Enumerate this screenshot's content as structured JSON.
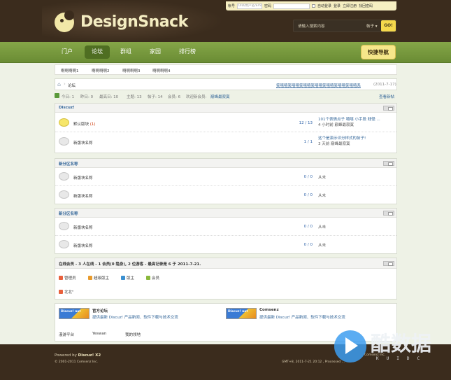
{
  "colors": {
    "header_bg": "#3b2c1d",
    "nav_green": "#6a8c34",
    "accent_yellow": "#f4d84c",
    "link_blue": "#336699",
    "new_count_red": "#cc3300"
  },
  "topbar": {
    "account_label": "帐号",
    "account_placeholder": "UID/用户名/Email",
    "password_label": "密码",
    "auto_login": "自动登录",
    "login": "登录",
    "register": "立即注册",
    "forgot": "找回密码"
  },
  "logo": {
    "text": "DesignSnack"
  },
  "search": {
    "placeholder": "请输入搜索内容",
    "type": "帖子",
    "button": "GO!"
  },
  "nav": {
    "items": [
      "门户",
      "论坛",
      "群组",
      "家园",
      "排行榜"
    ],
    "active": "论坛",
    "quick": "快捷导航"
  },
  "subnav": {
    "items": [
      "啊啊啊啊1",
      "啊啊啊啊2",
      "啊啊啊啊3",
      "啊啊啊啊4"
    ]
  },
  "breadcrumb": {
    "home_icon": "home-icon",
    "current": "论坛",
    "announcement": "笑嘻嘻笑嘻嘻笑嘻嘻笑嘻嘻笑嘻嘻笑嘻嘻笑嘻嘻系",
    "announcement_date": "(2011-7-17)"
  },
  "stats": {
    "today": "今日: 1",
    "yesterday": "昨日: 0",
    "max": "最高日: 10",
    "threads": "主题: 13",
    "posts": "帖子: 14",
    "members": "会员: 6",
    "welcome": "欢迎新会员:",
    "new_member": "巅峰最寂寞",
    "view_new": "查看新帖"
  },
  "sections": [
    {
      "title": "Discuz!",
      "forums": [
        {
          "name": "默认版块",
          "new_count": "(1)",
          "count": "12 / 13",
          "last_title": "101个表情点子 嘻嘻 小手段 贱怪 ...",
          "last_meta": "4 小时前 巅峰最寂寞",
          "is_new": true
        },
        {
          "name": "新版块名称",
          "new_count": "",
          "count": "1 / 1",
          "last_title": "这个是演示评分样式的帖子!",
          "last_meta": "3 天前 巅峰最寂寞",
          "is_new": false
        }
      ]
    },
    {
      "title": "新分区名称",
      "forums": [
        {
          "name": "新版块名称",
          "count": "0 / 0",
          "last_single": "从未"
        },
        {
          "name": "新版块名称",
          "count": "0 / 0",
          "last_single": "从未"
        }
      ]
    },
    {
      "title": "新分区名称",
      "forums": [
        {
          "name": "新版块名称",
          "count": "0 / 0",
          "last_single": "从未"
        },
        {
          "name": "新版块名称",
          "count": "0 / 0",
          "last_single": "从未"
        }
      ]
    }
  ],
  "online": {
    "title": "在线会员 - 3 人在线 - 1 会员(0 隐身), 2 位游客 - 最高记录是 6 于 2011-7-21.",
    "legend": [
      "管理员",
      "超级版主",
      "版主",
      "会员"
    ],
    "user": "北北\""
  },
  "links": [
    {
      "badge": "Discuz! net",
      "title": "官方论坛",
      "desc": "提供最新 Discuz! 产品新闻、软件下载与技术交流"
    },
    {
      "badge": "Discuz! net",
      "title": "Comsenz",
      "desc": "提供最新 Discuz! 产品新闻、软件下载与技术交流"
    }
  ],
  "plain_links": [
    "漫游平台",
    "Yeswan",
    "我的领地"
  ],
  "footer": {
    "powered_prefix": "Powered by",
    "product": "Discuz! X2",
    "copyright": "© 2001-2011 Comsenz Inc.",
    "gmt": "GMT+8, 2011-7-21 20:12 , Processed ...",
    "company": "Comsenz Inc."
  },
  "watermark": {
    "text": "酷数据",
    "sub": "KUIDC"
  }
}
